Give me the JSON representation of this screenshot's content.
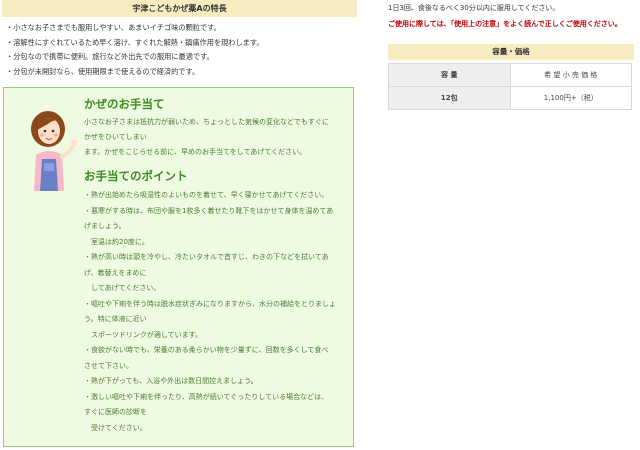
{
  "features": {
    "header": "宇津こどもかぜ薬Aの特長",
    "items": [
      "・小さなお子さまでも服用しやすい、あまいイチゴ味の顆粒です。",
      "・溶解性にすぐれているため早く溶け、すぐれた解熱・鎮痛作用を現わします。",
      "・分包なので携帯に便利。旅行など外出先での服用に最適です。",
      "・分包が未開封なら、使用期限まで使えるので経済的です。"
    ]
  },
  "care": {
    "title": "かぜのお手当て",
    "body": [
      "小さなお子さまは抵抗力が弱いため、ちょっとした気候の変化などでもすぐに",
      "かぜをひいてしまい",
      "ます。かぜをこじらせる前に、早めのお手当てをしてあげてください。"
    ],
    "points_title": "お手当てのポイント",
    "points": [
      "・熱が出始めたら吸湿性のよいものを着せて、早く寝かせてあげてください。",
      "・悪寒がする時は、布団や服を1枚多く着せたり靴下をはかせて身体を温めてあ",
      "げましょう。",
      "　室温は約20度に。",
      "・熱が高い時は頭を冷やし、冷たいタオルで首すじ、わきの下などを拭いてあ",
      "げ、着替えをまめに",
      "　してあげてください。",
      "・嘔吐や下痢を伴う時は脱水症状ぎみになりますから、水分の補給をとりましょ",
      "う。特に体液に近い",
      "　スポーツドリンクが適しています。",
      "・食欲がない時でも、栄養のある柔らかい物を少量ずに、回数を多くして食べ",
      "させて下さい。",
      "・熱が下がっても、入浴や外出は数日間控えましょう。",
      "・激しい嘔吐や下痢を伴ったり、高熱が続いてぐったりしている場合などは、",
      "すぐに医師の診断を",
      "　受けてください。"
    ]
  },
  "usage": {
    "dose": "1日3回、食後なるべく30分以内に服用してください。",
    "caution_pre": "ご使用に際しては、",
    "caution_mid": "「使用上の注意」",
    "caution_post": "をよく読んで正しくご使用ください。"
  },
  "price": {
    "header": "容量・価格",
    "col_capacity": "容 量",
    "col_price": "希 望 小 売 価 格",
    "row_capacity": "12包",
    "row_price": "1,100円+（税）"
  }
}
